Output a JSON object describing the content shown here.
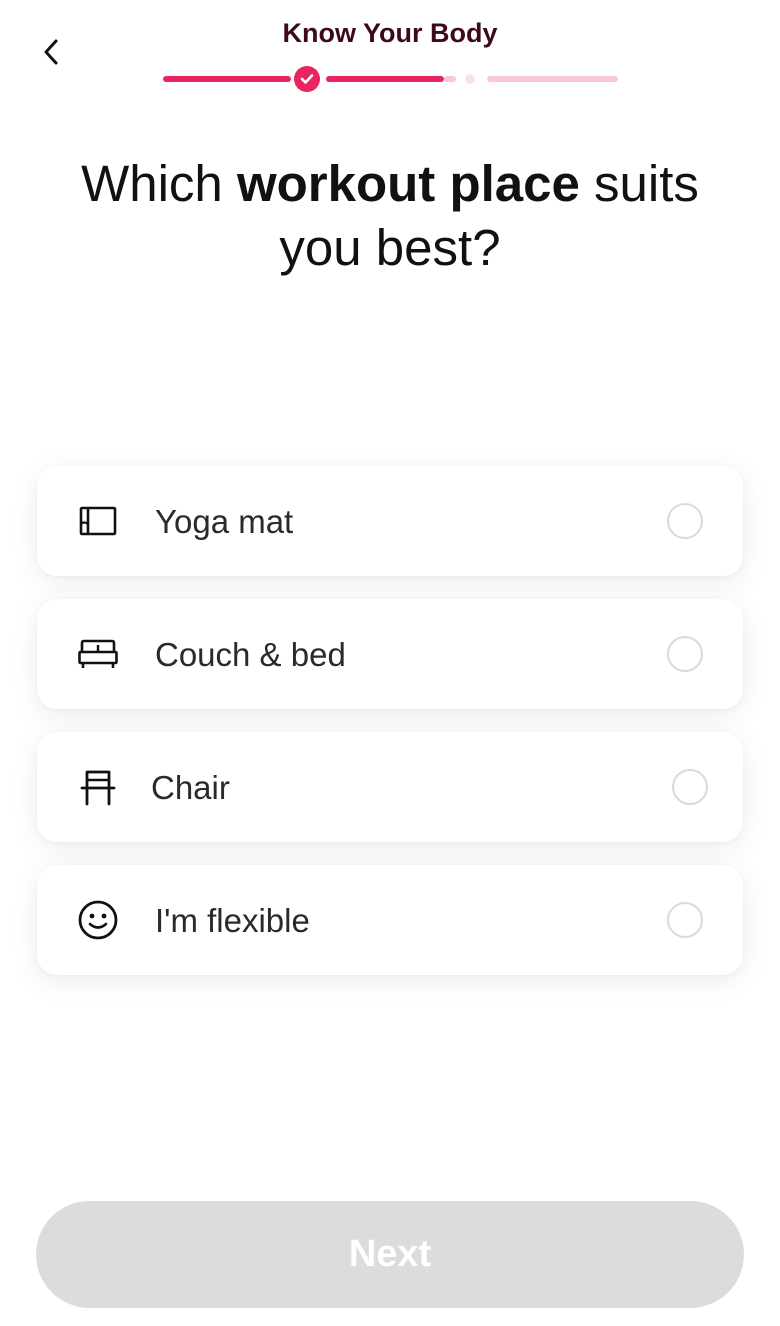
{
  "header": {
    "title": "Know Your Body",
    "back_icon": "chevron-left-icon"
  },
  "progress": {
    "accent_color": "#e8255f",
    "inactive_color": "#f7c9d6",
    "completed_steps": 1,
    "current_step": 2,
    "total_steps": 3
  },
  "question": {
    "prefix": "Which",
    "emphasis": "workout place",
    "suffix": "suits you best?"
  },
  "options": [
    {
      "label": "Yoga mat",
      "icon": "yoga-mat-icon",
      "selected": false
    },
    {
      "label": "Couch & bed",
      "icon": "bed-icon",
      "selected": false
    },
    {
      "label": "Chair",
      "icon": "chair-icon",
      "selected": false
    },
    {
      "label": "I'm flexible",
      "icon": "smiley-icon",
      "selected": false
    }
  ],
  "next_button": {
    "label": "Next",
    "enabled": false,
    "color": "#dcdcdc"
  }
}
